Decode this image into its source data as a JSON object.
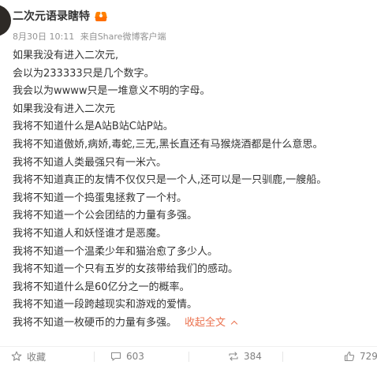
{
  "post": {
    "author": "二次元语录瞎特",
    "date": "8月30日 10:11",
    "from_prefix": "来自",
    "source": "Share微博客户端",
    "lines": [
      "如果我没有进入二次元,",
      "会以为233333只是几个数字。",
      "我会以为wwww只是一堆意义不明的字母。",
      "如果我没有进入二次元",
      "我将不知道什么是A站B站C站P站。",
      "我将不知道傲娇,病娇,毒蛇,三无,黑长直还有马猴烧酒都是什么意思。",
      "我将不知道人类最强只有一米六。",
      "我将不知道真正的友情不仅仅只是一个人,还可以是一只驯鹿,一艘船。",
      "我将不知道一个捣蛋鬼拯救了一个村。",
      "我将不知道一个公会团结的力量有多强。",
      "我将不知道人和妖怪谁才是恶魔。",
      "我将不知道一个温柔少年和猫治愈了多少人。",
      "我将不知道一个只有五岁的女孩带给我们的感动。",
      "我将不知道什么是60亿分之一的概率。",
      "我将不知道一段跨越现实和游戏的爱情。"
    ],
    "last_line": "我将不知道一枚硬币的力量有多强。",
    "collapse_label": "收起全文"
  },
  "actions": {
    "favorite_label": "收藏",
    "comment_count": "603",
    "repost_count": "384",
    "like_count": "729"
  },
  "icons": {
    "badge": "vip-crown-icon",
    "favorite": "star-icon",
    "comment": "comment-icon",
    "repost": "repost-icon",
    "like": "thumbs-up-icon",
    "collapse": "chevron-up-icon"
  },
  "colors": {
    "link": "#eb7350",
    "meta": "#939393",
    "badge": "#ff8200"
  }
}
